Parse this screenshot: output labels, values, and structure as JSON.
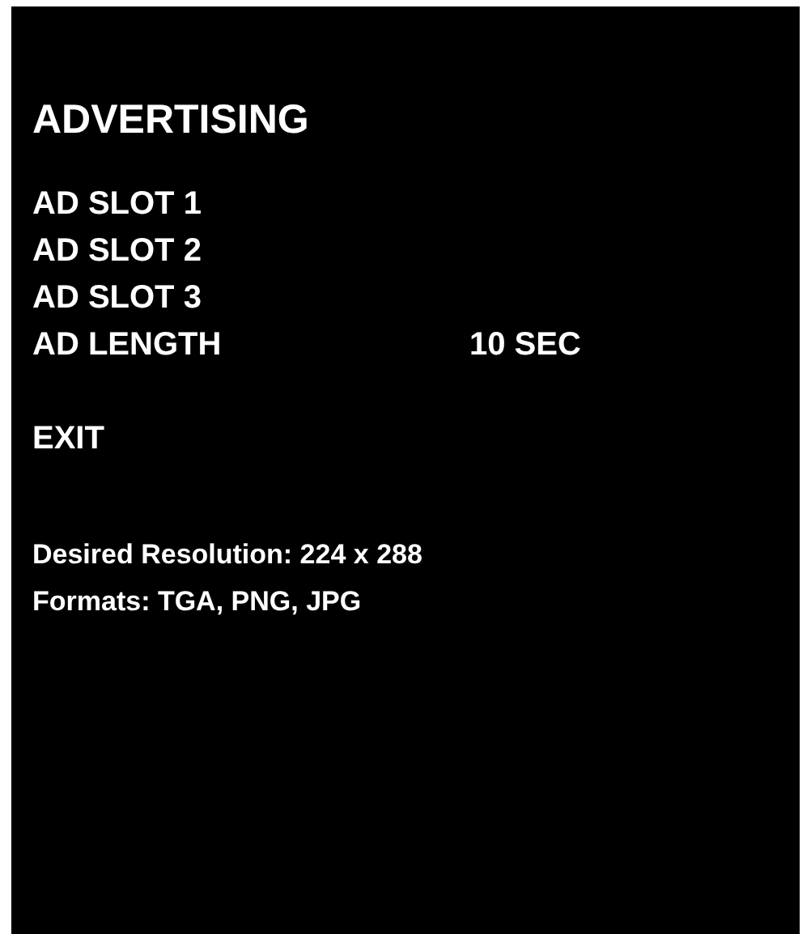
{
  "title": "ADVERTISING",
  "menu_items": [
    {
      "label": "AD SLOT 1"
    },
    {
      "label": "AD SLOT 2"
    },
    {
      "label": "AD SLOT 3"
    },
    {
      "label": "AD LENGTH",
      "value": "10 SEC"
    }
  ],
  "exit": "EXIT",
  "info_lines": [
    "Desired Resolution: 224 x 288",
    "Formats: TGA, PNG, JPG"
  ]
}
